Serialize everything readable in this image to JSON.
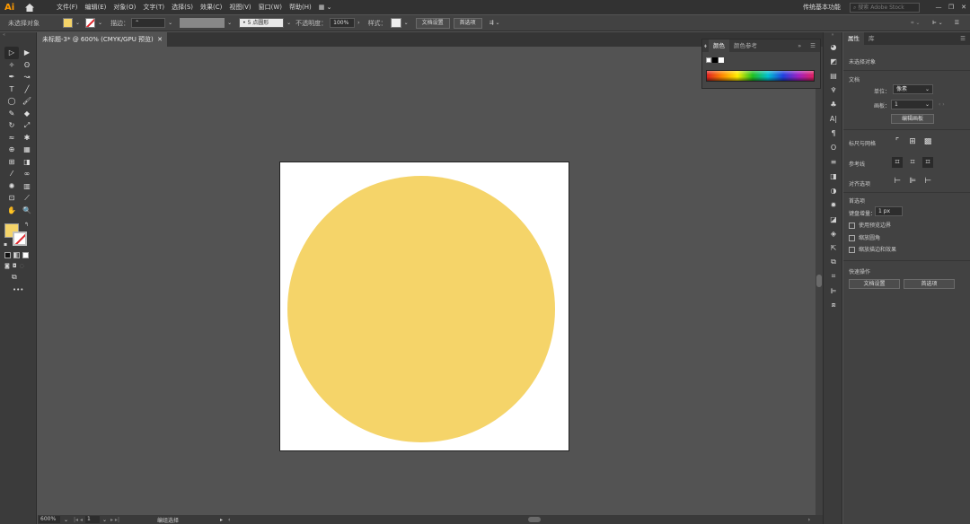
{
  "app": {
    "logo": "Ai",
    "menu": [
      "文件(F)",
      "编辑(E)",
      "对象(O)",
      "文字(T)",
      "选择(S)",
      "效果(C)",
      "视图(V)",
      "窗口(W)",
      "帮助(H)"
    ],
    "workspace": "传统基本功能",
    "search_placeholder": "搜索 Adobe Stock",
    "window_buttons": [
      "—",
      "❐",
      "✕"
    ]
  },
  "control_bar": {
    "selection_status": "未选择对象",
    "stroke_label": "描边：",
    "brush_label": "• 5 点圆形",
    "opacity_label": "不透明度：",
    "opacity_value": "100%",
    "style_label": "样式：",
    "doc_setup_button": "文档设置",
    "preferences_button": "首选项",
    "fill_color": "#f5d469"
  },
  "document": {
    "tab_title": "未标题-3* @ 600% (CMYK/GPU 预览)",
    "close_glyph": "✕",
    "artboard_color": "#ffffff",
    "circle_color": "#f5d469"
  },
  "status_bar": {
    "zoom": "600%",
    "artboard_number": "1",
    "mode": "编组选择"
  },
  "color_panel": {
    "tabs": [
      "颜色",
      "颜色参考"
    ],
    "active_tab": "颜色"
  },
  "properties": {
    "tabs": [
      "属性",
      "库"
    ],
    "active_tab": "属性",
    "no_selection": "未选择对象",
    "document_header": "文档",
    "units_label": "单位：",
    "units_value": "像素",
    "artboard_label": "画板：",
    "artboard_value": "1",
    "edit_artboards_button": "编辑画板",
    "rulers_grids_label": "标尺与网格",
    "guides_label": "参考线",
    "snap_options_label": "对齐选项",
    "preferences_header": "首选项",
    "keyboard_increment_label": "键盘增量：",
    "keyboard_increment_value": "1 px",
    "use_preview_bounds": "使用预览边界",
    "scale_corners": "缩放圆角",
    "scale_strokes_effects": "缩放描边和效果",
    "quick_actions_header": "快速操作",
    "doc_setup_button": "文档设置",
    "preferences_button": "首选项"
  },
  "toolbar": {
    "tools": [
      {
        "name": "selection-tool",
        "glyph": "▷"
      },
      {
        "name": "direct-selection-tool",
        "glyph": "▶"
      },
      {
        "name": "magic-wand-tool",
        "glyph": "✧"
      },
      {
        "name": "lasso-tool",
        "glyph": "ʘ"
      },
      {
        "name": "pen-tool",
        "glyph": "✒"
      },
      {
        "name": "curvature-tool",
        "glyph": "↝"
      },
      {
        "name": "type-tool",
        "glyph": "T"
      },
      {
        "name": "line-tool",
        "glyph": "╱"
      },
      {
        "name": "ellipse-tool",
        "glyph": "◯"
      },
      {
        "name": "paintbrush-tool",
        "glyph": "🖌"
      },
      {
        "name": "shaper-tool",
        "glyph": "✎"
      },
      {
        "name": "eraser-tool",
        "glyph": "◆"
      },
      {
        "name": "rotate-tool",
        "glyph": "↻"
      },
      {
        "name": "scale-tool",
        "glyph": "⤢"
      },
      {
        "name": "width-tool",
        "glyph": "≈"
      },
      {
        "name": "puppet-warp-tool",
        "glyph": "✱"
      },
      {
        "name": "shape-builder-tool",
        "glyph": "⊕"
      },
      {
        "name": "perspective-grid-tool",
        "glyph": "▦"
      },
      {
        "name": "mesh-tool",
        "glyph": "⊞"
      },
      {
        "name": "gradient-tool",
        "glyph": "◨"
      },
      {
        "name": "eyedropper-tool",
        "glyph": "⁄"
      },
      {
        "name": "blend-tool",
        "glyph": "∞"
      },
      {
        "name": "symbol-sprayer-tool",
        "glyph": "✺"
      },
      {
        "name": "column-graph-tool",
        "glyph": "▥"
      },
      {
        "name": "artboard-tool",
        "glyph": "⊡"
      },
      {
        "name": "slice-tool",
        "glyph": "⟋"
      },
      {
        "name": "hand-tool",
        "glyph": "✋"
      },
      {
        "name": "zoom-tool",
        "glyph": "🔍"
      }
    ],
    "more_glyph": "•••"
  }
}
